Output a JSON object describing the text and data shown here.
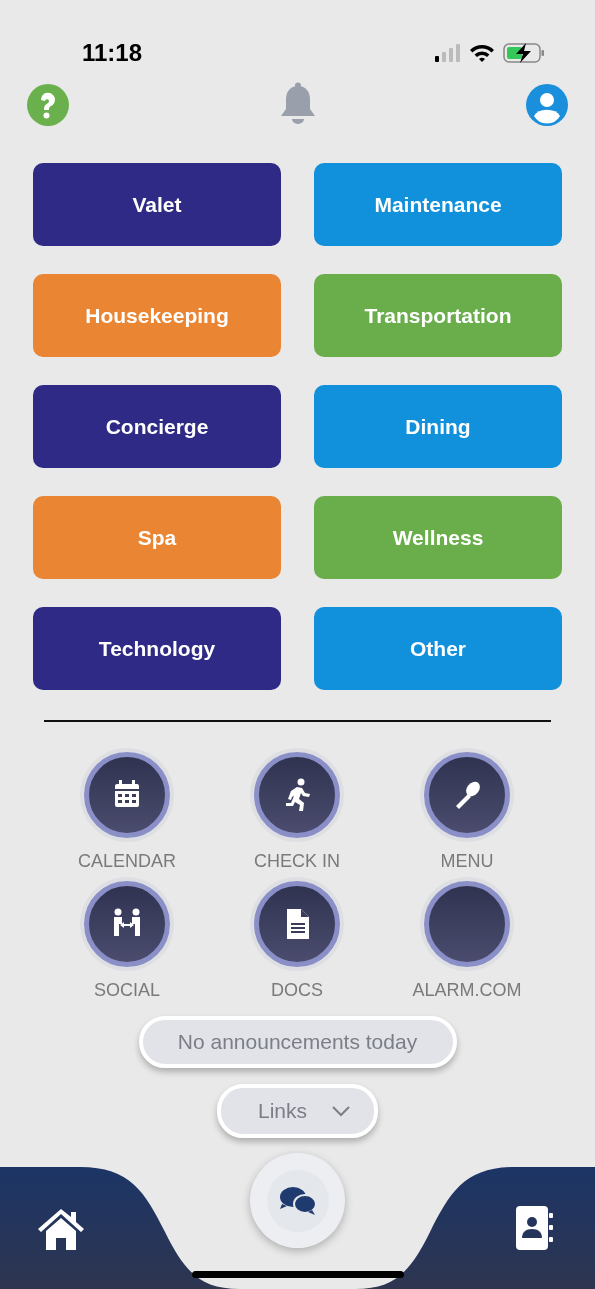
{
  "status_bar": {
    "time": "11:18"
  },
  "services": [
    {
      "label": "Valet",
      "color": "#2f2a86"
    },
    {
      "label": "Maintenance",
      "color": "#1190db"
    },
    {
      "label": "Housekeeping",
      "color": "#ea8533"
    },
    {
      "label": "Transportation",
      "color": "#6aae4c"
    },
    {
      "label": "Concierge",
      "color": "#2f2a86"
    },
    {
      "label": "Dining",
      "color": "#1190db"
    },
    {
      "label": "Spa",
      "color": "#ea8533"
    },
    {
      "label": "Wellness",
      "color": "#6aae4c"
    },
    {
      "label": "Technology",
      "color": "#2f2a86"
    },
    {
      "label": "Other",
      "color": "#1190db"
    }
  ],
  "shortcuts": [
    {
      "label": "CALENDAR",
      "kind": "calendar"
    },
    {
      "label": "CHECK IN",
      "kind": "runner"
    },
    {
      "label": "MENU",
      "kind": "spoon"
    },
    {
      "label": "SOCIAL",
      "kind": "people"
    },
    {
      "label": "DOCS",
      "kind": "document"
    },
    {
      "label": "ALARM.COM",
      "kind": "blank"
    }
  ],
  "announcement": "No announcements today",
  "links_dropdown": {
    "label": "Links",
    "expanded": false
  }
}
